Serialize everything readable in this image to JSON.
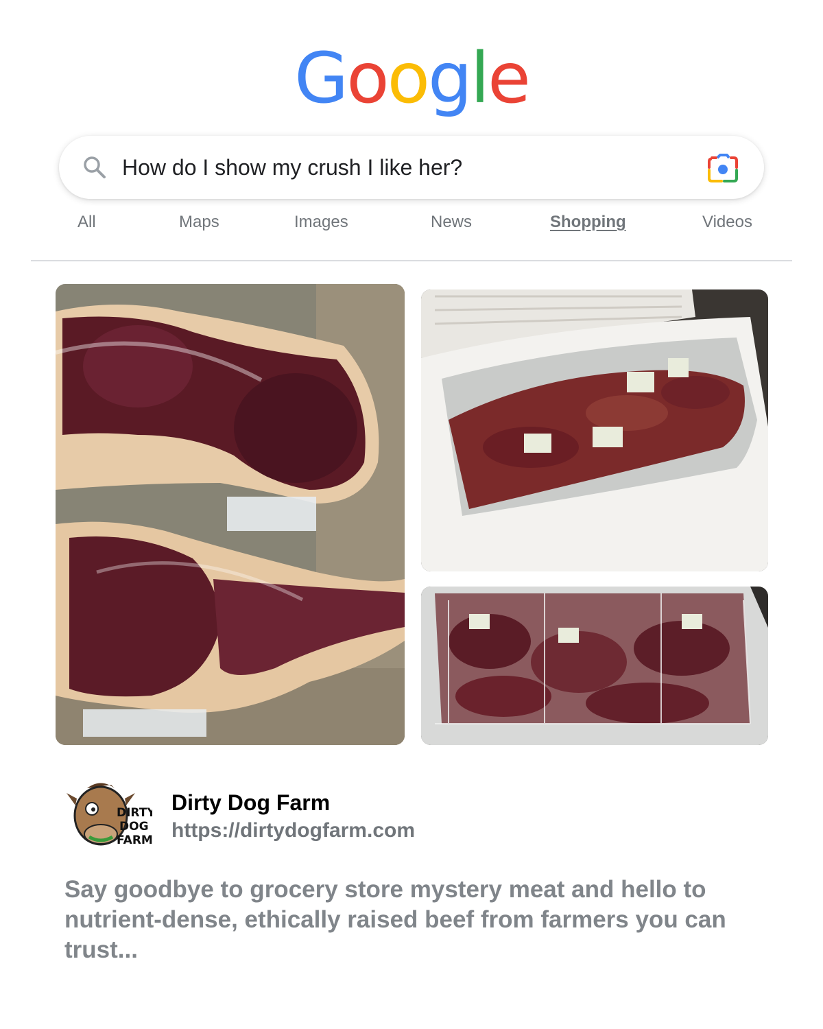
{
  "logo": {
    "letters": [
      "G",
      "o",
      "o",
      "g",
      "l",
      "e"
    ],
    "colors": [
      "#4285F4",
      "#EA4335",
      "#FBBC05",
      "#4285F4",
      "#34A853",
      "#EA4335"
    ]
  },
  "search": {
    "query": "How do I show my crush I like her?",
    "left_icon": "search-icon",
    "right_icon": "google-lens-icon"
  },
  "tabs": [
    {
      "label": "All",
      "active": false
    },
    {
      "label": "Maps",
      "active": false
    },
    {
      "label": "Images",
      "active": false
    },
    {
      "label": "News",
      "active": false
    },
    {
      "label": "Shopping",
      "active": true
    },
    {
      "label": "Videos",
      "active": false
    }
  ],
  "images": [
    {
      "name": "vacuum-sealed-tomahawk-steaks"
    },
    {
      "name": "chest-freezer-with-beef-cuts"
    },
    {
      "name": "freezer-baskets-ground-beef"
    }
  ],
  "result": {
    "site_name": "Dirty Dog Farm",
    "url": "https://dirtydogfarm.com",
    "logo_text": [
      "DIRTY",
      "DOG",
      "FARM"
    ],
    "snippet": "Say goodbye to grocery store mystery meat and hello to nutrient-dense, ethically raised beef from farmers you can trust..."
  }
}
